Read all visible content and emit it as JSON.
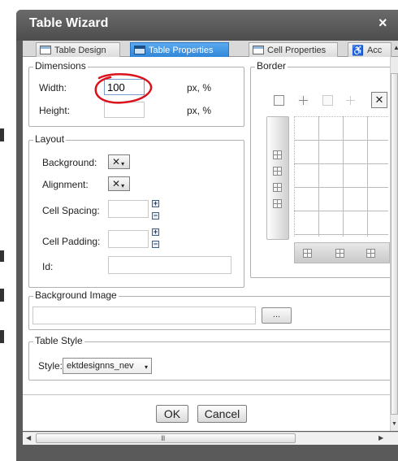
{
  "dialog": {
    "title": "Table Wizard",
    "close_glyph": "×"
  },
  "tabs": [
    {
      "label": "Table Design",
      "active": false
    },
    {
      "label": "Table Properties",
      "active": true
    },
    {
      "label": "Cell Properties",
      "active": false
    },
    {
      "label": "Acc",
      "active": false
    }
  ],
  "dimensions": {
    "legend": "Dimensions",
    "width_label": "Width:",
    "width_value": "100",
    "width_unit": "px, %",
    "height_label": "Height:",
    "height_value": "",
    "height_unit": "px, %"
  },
  "border": {
    "legend": "Border",
    "x_glyph": "✕"
  },
  "layout": {
    "legend": "Layout",
    "background_label": "Background:",
    "alignment_label": "Alignment:",
    "cell_spacing_label": "Cell Spacing:",
    "cell_padding_label": "Cell Padding:",
    "id_label": "Id:",
    "color_glyph": "✕",
    "caret": "▾",
    "plus": "+",
    "minus": "−"
  },
  "background_image": {
    "legend": "Background Image",
    "value": "",
    "browse_label": "..."
  },
  "table_style": {
    "legend": "Table Style",
    "style_label": "Style:",
    "selected": "ektdesignns_nev",
    "caret": "▾"
  },
  "footer": {
    "ok_label": "OK",
    "cancel_label": "Cancel"
  },
  "scrollbar": {
    "left_arrow": "◀",
    "right_arrow": "▶",
    "up_arrow": "▲",
    "down_arrow": "▼",
    "grip": "III"
  },
  "colors": {
    "titlebar": "#5a5a5a",
    "active_tab": "#2f86d8",
    "annotation": "#d9121b"
  }
}
